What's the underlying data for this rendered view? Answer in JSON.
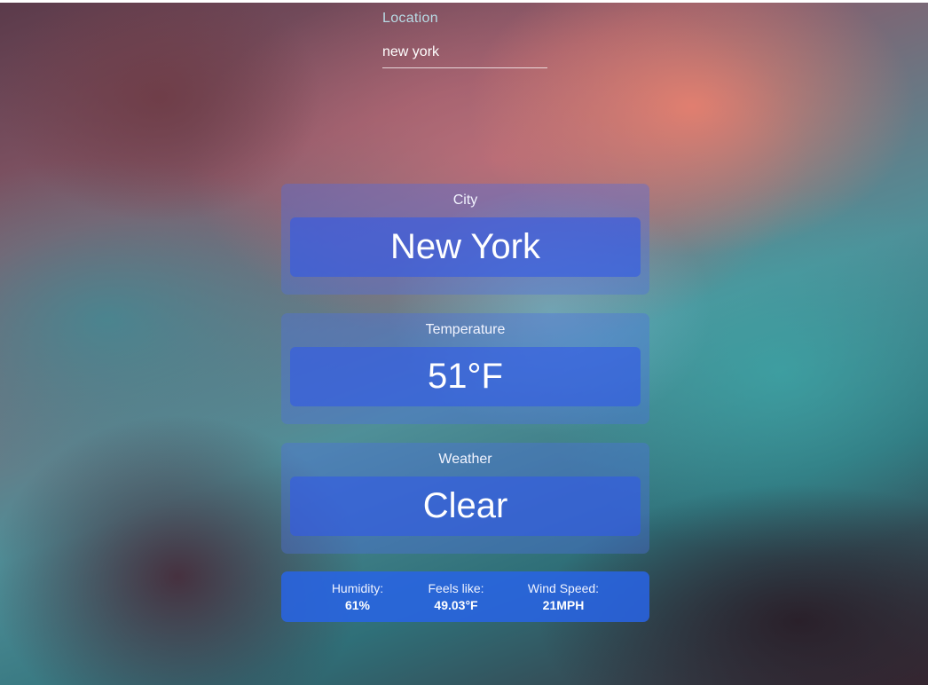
{
  "search": {
    "label": "Location",
    "value": "new york"
  },
  "cards": [
    {
      "title": "City",
      "value": "New York"
    },
    {
      "title": "Temperature",
      "value": "51°F"
    },
    {
      "title": "Weather",
      "value": "Clear"
    }
  ],
  "stats": {
    "humidity": {
      "label": "Humidity:",
      "value": "61%"
    },
    "feels_like": {
      "label": "Feels like:",
      "value": "49.03°F"
    },
    "wind_speed": {
      "label": "Wind Speed:",
      "value": "21MPH"
    }
  },
  "colors": {
    "card": "#506ee6",
    "value_box": "#325ae6",
    "stats_bar": "#2864e6"
  }
}
